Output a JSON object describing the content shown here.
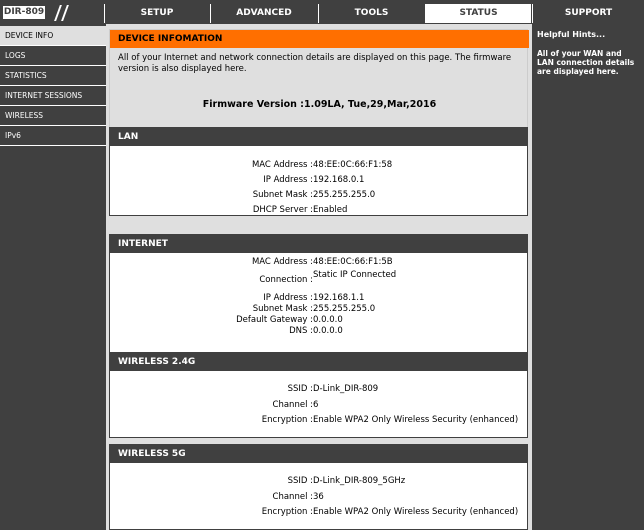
{
  "model": "DIR-809",
  "tabs": [
    {
      "label": "SETUP"
    },
    {
      "label": "ADVANCED"
    },
    {
      "label": "TOOLS"
    },
    {
      "label": "STATUS"
    },
    {
      "label": "SUPPORT"
    }
  ],
  "sidebar": {
    "items": [
      {
        "label": "DEVICE INFO"
      },
      {
        "label": "LOGS"
      },
      {
        "label": "STATISTICS"
      },
      {
        "label": "INTERNET SESSIONS"
      },
      {
        "label": "WIRELESS"
      },
      {
        "label": "IPv6"
      }
    ]
  },
  "device_info": {
    "title": "DEVICE INFOMATION",
    "description": "All of your Internet and network connection details are displayed on this page. The firmware version is also displayed here.",
    "firmware": "Firmware Version :1.09LA,  Tue,29,Mar,2016"
  },
  "lan": {
    "title": "LAN",
    "mac_label": "MAC Address :",
    "mac": "48:EE:0C:66:F1:58",
    "ip_label": "IP Address :",
    "ip": "192.168.0.1",
    "mask_label": "Subnet Mask :",
    "mask": "255.255.255.0",
    "dhcp_label": "DHCP Server :",
    "dhcp": "Enabled"
  },
  "internet": {
    "title": "INTERNET",
    "mac_label": "MAC Address :",
    "mac": "48:EE:0C:66:F1:5B",
    "conn_label": "Connection :",
    "conn": "Static IP Connected",
    "ip_label": "IP Address :",
    "ip": "192.168.1.1",
    "mask_label": "Subnet Mask :",
    "mask": "255.255.255.0",
    "gw_label": "Default Gateway :",
    "gw": "0.0.0.0",
    "dns_label": "DNS :",
    "dns": "0.0.0.0"
  },
  "wireless24": {
    "title": "WIRELESS 2.4G",
    "ssid_label": "SSID :",
    "ssid": "D-Link_DIR-809",
    "channel_label": "Channel :",
    "channel": "6",
    "enc_label": "Encryption :",
    "enc": "Enable WPA2 Only Wireless Security (enhanced)"
  },
  "wireless5": {
    "title": "WIRELESS 5G",
    "ssid_label": "SSID :",
    "ssid": "D-Link_DIR-809_5GHz",
    "channel_label": "Channel :",
    "channel": "36",
    "enc_label": "Encryption :",
    "enc": "Enable WPA2 Only Wireless Security (enhanced)"
  },
  "hints": {
    "title": "Helpful Hints...",
    "body": "All of your WAN and LAN connection details are displayed here."
  }
}
